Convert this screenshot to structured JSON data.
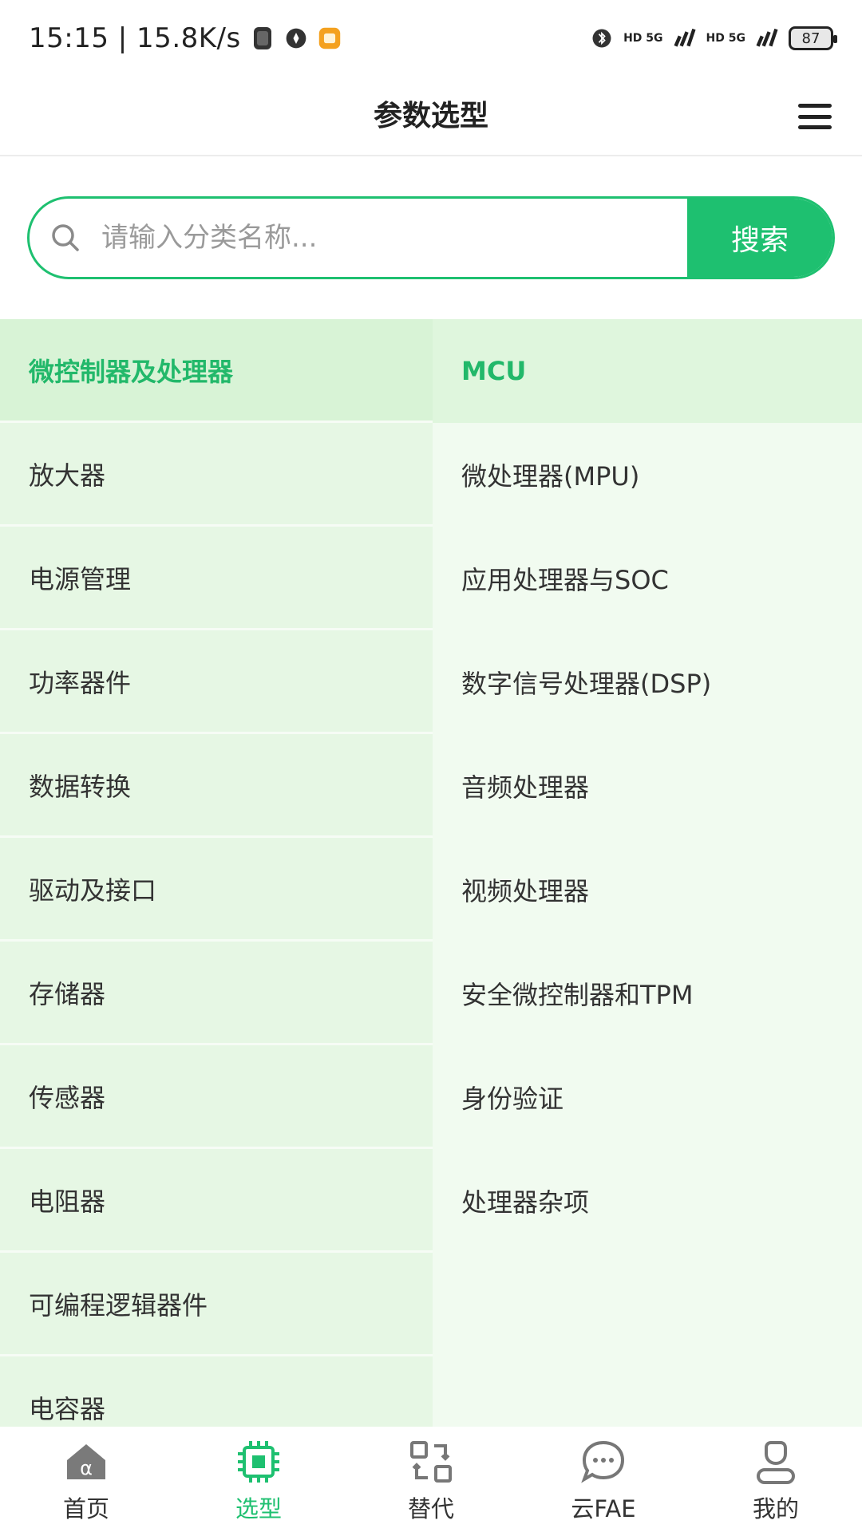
{
  "status_bar": {
    "time": "15:15 | 15.8K/s",
    "signal_1": "HD 5G",
    "signal_2": "HD 5G",
    "battery": "87"
  },
  "header": {
    "title": "参数选型",
    "menu_icon": "hamburger-menu-icon"
  },
  "search": {
    "placeholder": "请输入分类名称...",
    "value": "",
    "button_label": "搜索",
    "icon": "search-icon"
  },
  "categories": {
    "primary": [
      {
        "label": "微控制器及处理器",
        "active": true
      },
      {
        "label": "放大器"
      },
      {
        "label": "电源管理"
      },
      {
        "label": "功率器件"
      },
      {
        "label": "数据转换"
      },
      {
        "label": "驱动及接口"
      },
      {
        "label": "存储器"
      },
      {
        "label": "传感器"
      },
      {
        "label": "电阻器"
      },
      {
        "label": "可编程逻辑器件"
      },
      {
        "label": "电容器"
      }
    ],
    "secondary": [
      {
        "label": "MCU",
        "active": true
      },
      {
        "label": "微处理器(MPU)"
      },
      {
        "label": "应用处理器与SOC"
      },
      {
        "label": "数字信号处理器(DSP)"
      },
      {
        "label": "音频处理器"
      },
      {
        "label": "视频处理器"
      },
      {
        "label": "安全微控制器和TPM"
      },
      {
        "label": "身份验证"
      },
      {
        "label": "处理器杂项"
      }
    ]
  },
  "bottom_nav": {
    "items": [
      {
        "label": "首页",
        "icon": "home-icon"
      },
      {
        "label": "选型",
        "icon": "chip-icon",
        "active": true
      },
      {
        "label": "替代",
        "icon": "swap-icon"
      },
      {
        "label": "云FAE",
        "icon": "chat-bubble-icon"
      },
      {
        "label": "我的",
        "icon": "user-icon"
      }
    ]
  },
  "colors": {
    "accent": "#1ec070",
    "active_text": "#22b86a",
    "left_bg": "#e6f7e4",
    "right_bg": "#f1fbf0"
  }
}
